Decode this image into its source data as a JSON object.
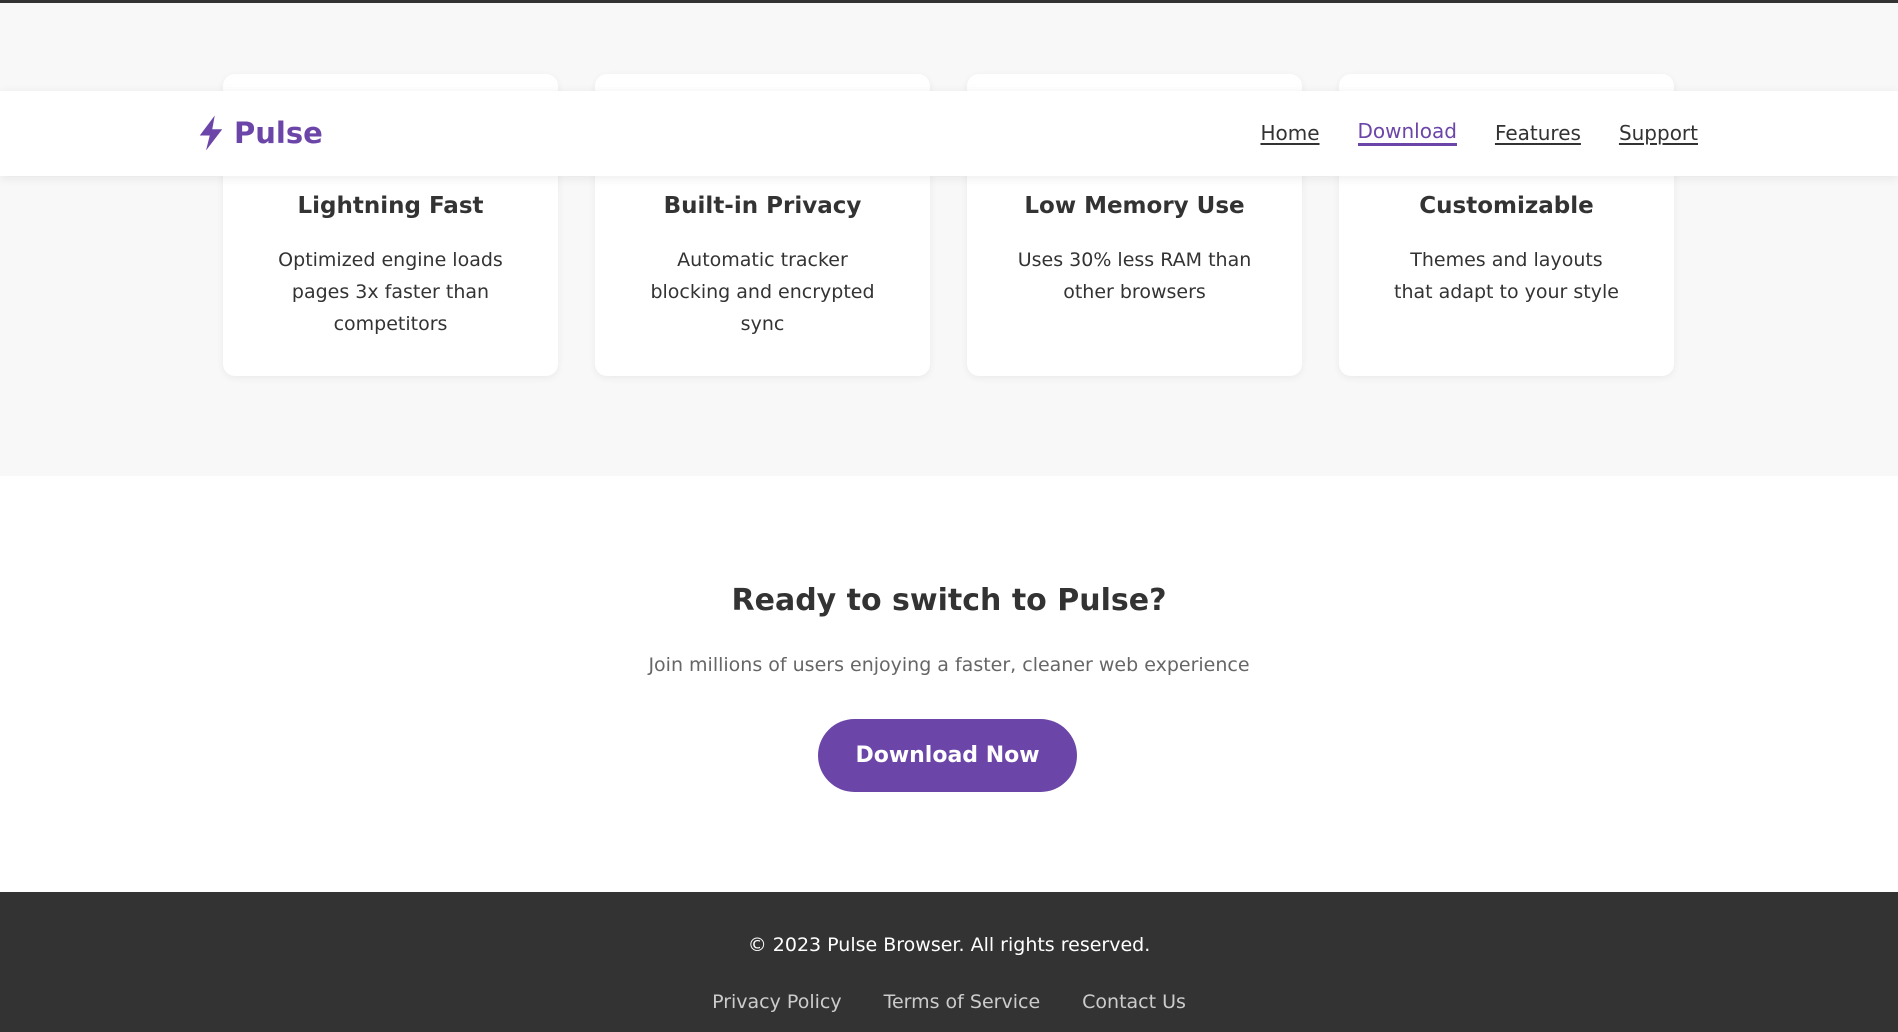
{
  "brand": {
    "name": "Pulse",
    "accent_color": "#6b46a8",
    "logo_icon": "lightning-bolt-icon"
  },
  "nav": {
    "items": [
      {
        "label": "Home",
        "active": false
      },
      {
        "label": "Download",
        "active": true
      },
      {
        "label": "Features",
        "active": false
      },
      {
        "label": "Support",
        "active": false
      }
    ]
  },
  "features": [
    {
      "title": "Lightning Fast",
      "description": "Optimized engine loads pages 3x faster than competitors"
    },
    {
      "title": "Built-in Privacy",
      "description": "Automatic tracker blocking and encrypted sync"
    },
    {
      "title": "Low Memory Use",
      "description": "Uses 30% less RAM than other browsers"
    },
    {
      "title": "Customizable",
      "description": "Themes and layouts that adapt to your style"
    }
  ],
  "cta": {
    "heading": "Ready to switch to Pulse?",
    "subtext": "Join millions of users enjoying a faster, cleaner web experience",
    "button_label": "Download Now"
  },
  "footer": {
    "copyright": "© 2023 Pulse Browser. All rights reserved.",
    "links": [
      "Privacy Policy",
      "Terms of Service",
      "Contact Us"
    ],
    "background_color": "#333333"
  }
}
